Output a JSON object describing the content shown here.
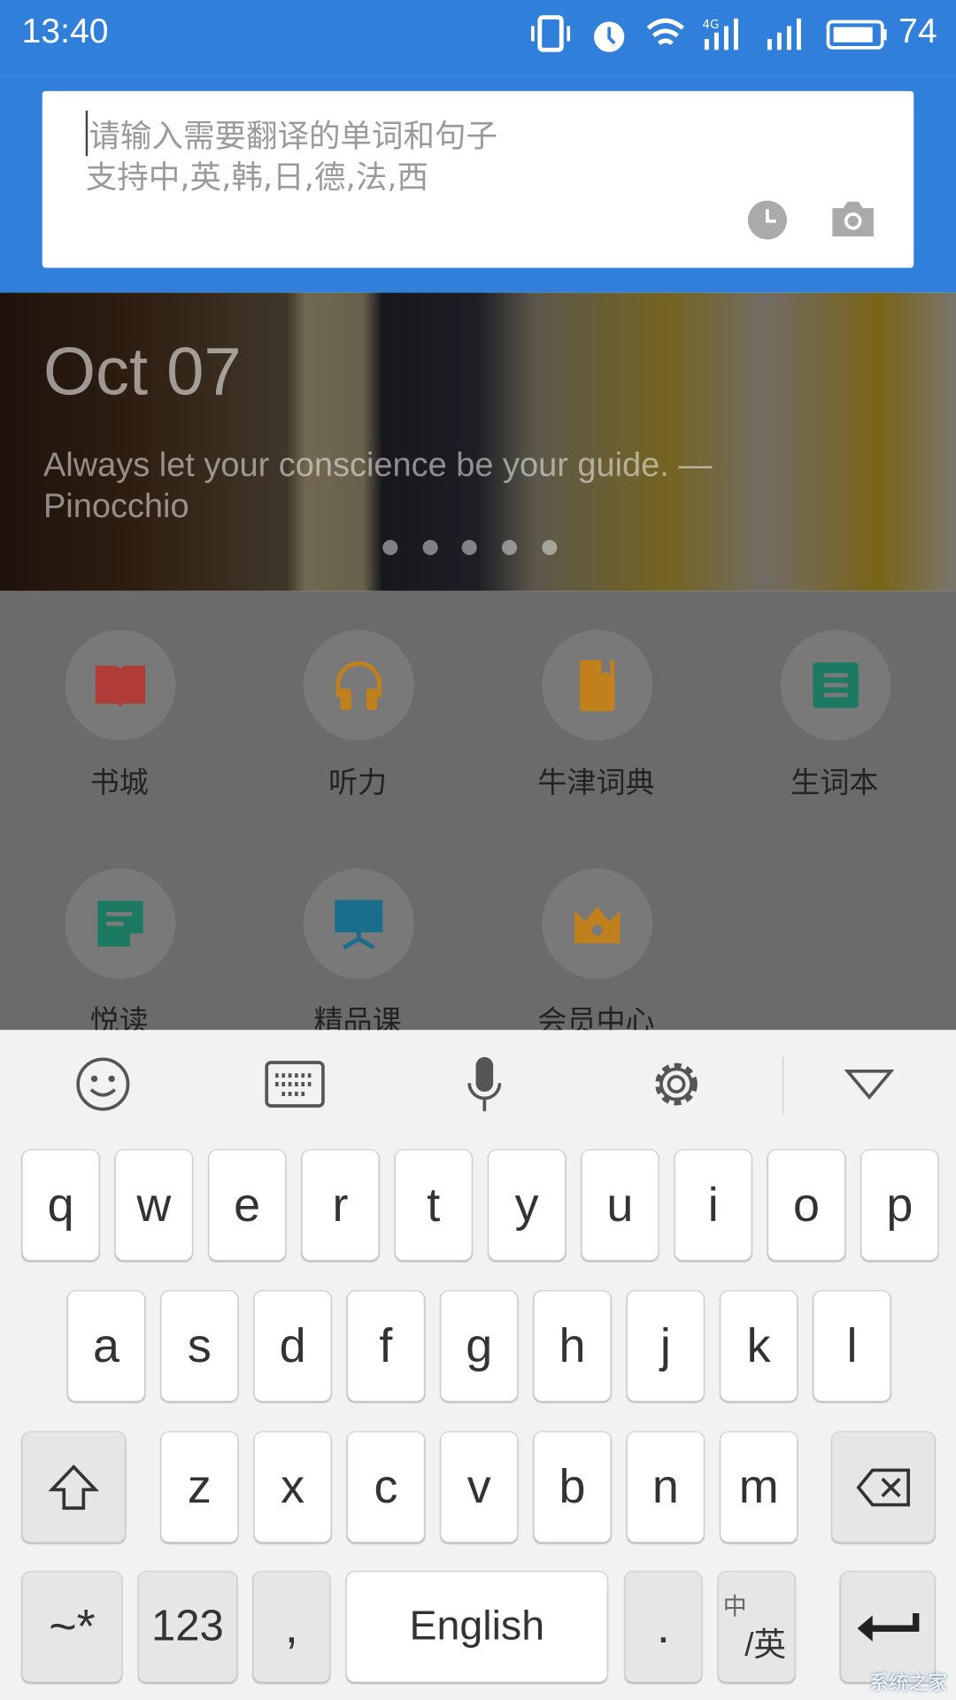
{
  "status_bar": {
    "time": "13:40",
    "battery": "74",
    "network": "4G",
    "icons": [
      "vibrate-icon",
      "alarm-icon",
      "wifi-icon",
      "signal-4g-icon",
      "signal-icon",
      "battery-icon"
    ]
  },
  "search": {
    "placeholder_line1": "请输入需要翻译的单词和句子",
    "placeholder_line2": "支持中,英,韩,日,德,法,西",
    "icons": [
      "history-icon",
      "camera-icon"
    ]
  },
  "banner": {
    "date": "Oct 07",
    "quote": "Always let your conscience be your guide. — Pinocchio",
    "pages": 5,
    "active_page": 1
  },
  "grid": {
    "items": [
      {
        "label": "书城",
        "icon": "book-icon",
        "color": "#c0433f"
      },
      {
        "label": "听力",
        "icon": "headphones-icon",
        "color": "#d08a1e"
      },
      {
        "label": "牛津词典",
        "icon": "dictionary-icon",
        "color": "#d08a1e"
      },
      {
        "label": "生词本",
        "icon": "notebook-icon",
        "color": "#1f8a6e"
      },
      {
        "label": "悦读",
        "icon": "reading-icon",
        "color": "#1f8a6e"
      },
      {
        "label": "精品课",
        "icon": "course-icon",
        "color": "#1d7fa0"
      },
      {
        "label": "会员中心",
        "icon": "crown-icon",
        "color": "#d08a1e"
      }
    ]
  },
  "keyboard": {
    "toolbar": [
      "emoji-icon",
      "keyboard-icon",
      "microphone-icon",
      "settings-icon",
      "collapse-icon"
    ],
    "row1": [
      "q",
      "w",
      "e",
      "r",
      "t",
      "y",
      "u",
      "i",
      "o",
      "p"
    ],
    "row2": [
      "a",
      "s",
      "d",
      "f",
      "g",
      "h",
      "j",
      "k",
      "l"
    ],
    "row3": [
      "z",
      "x",
      "c",
      "v",
      "b",
      "n",
      "m"
    ],
    "symbols": "~*",
    "numbers": "123",
    "comma": ",",
    "space": "English",
    "period": ".",
    "lang_top": "中",
    "lang_bottom": "/英"
  },
  "watermark": "系统之家"
}
